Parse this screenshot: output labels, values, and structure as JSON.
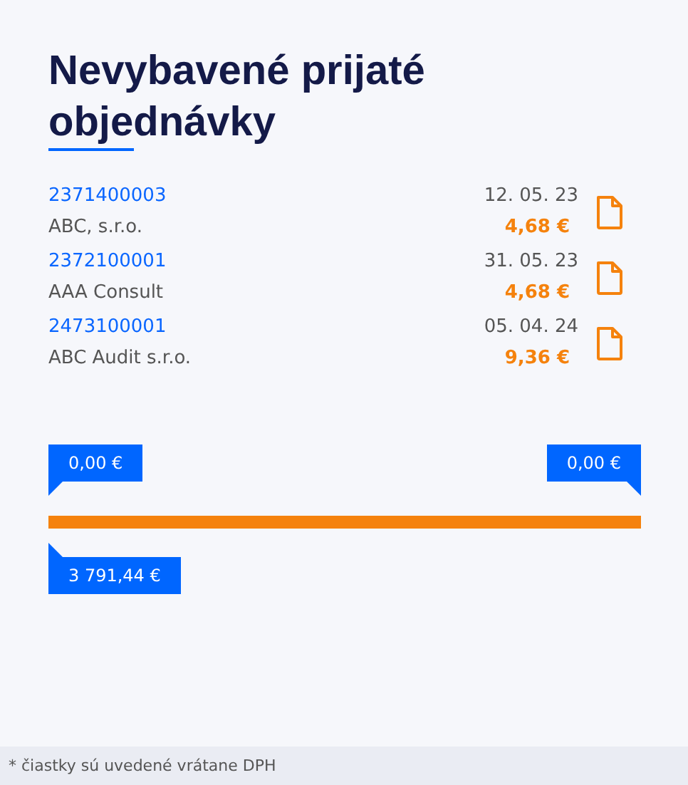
{
  "title": "Nevybavené prijaté objednávky",
  "orders": [
    {
      "number": "2371400003",
      "customer": "ABC, s.r.o.",
      "date": "12. 05. 23",
      "amount": "4,68 €"
    },
    {
      "number": "2372100001",
      "customer": "AAA Consult",
      "date": "31. 05. 23",
      "amount": "4,68 €"
    },
    {
      "number": "2473100001",
      "customer": "ABC Audit s.r.o.",
      "date": "05. 04. 24",
      "amount": "9,36 €"
    }
  ],
  "progress": {
    "start_label": "0,00 €",
    "end_label": "0,00 €",
    "total_label": "3 791,44 €"
  },
  "footnote": "* čiastky sú uvedené vrátane DPH"
}
